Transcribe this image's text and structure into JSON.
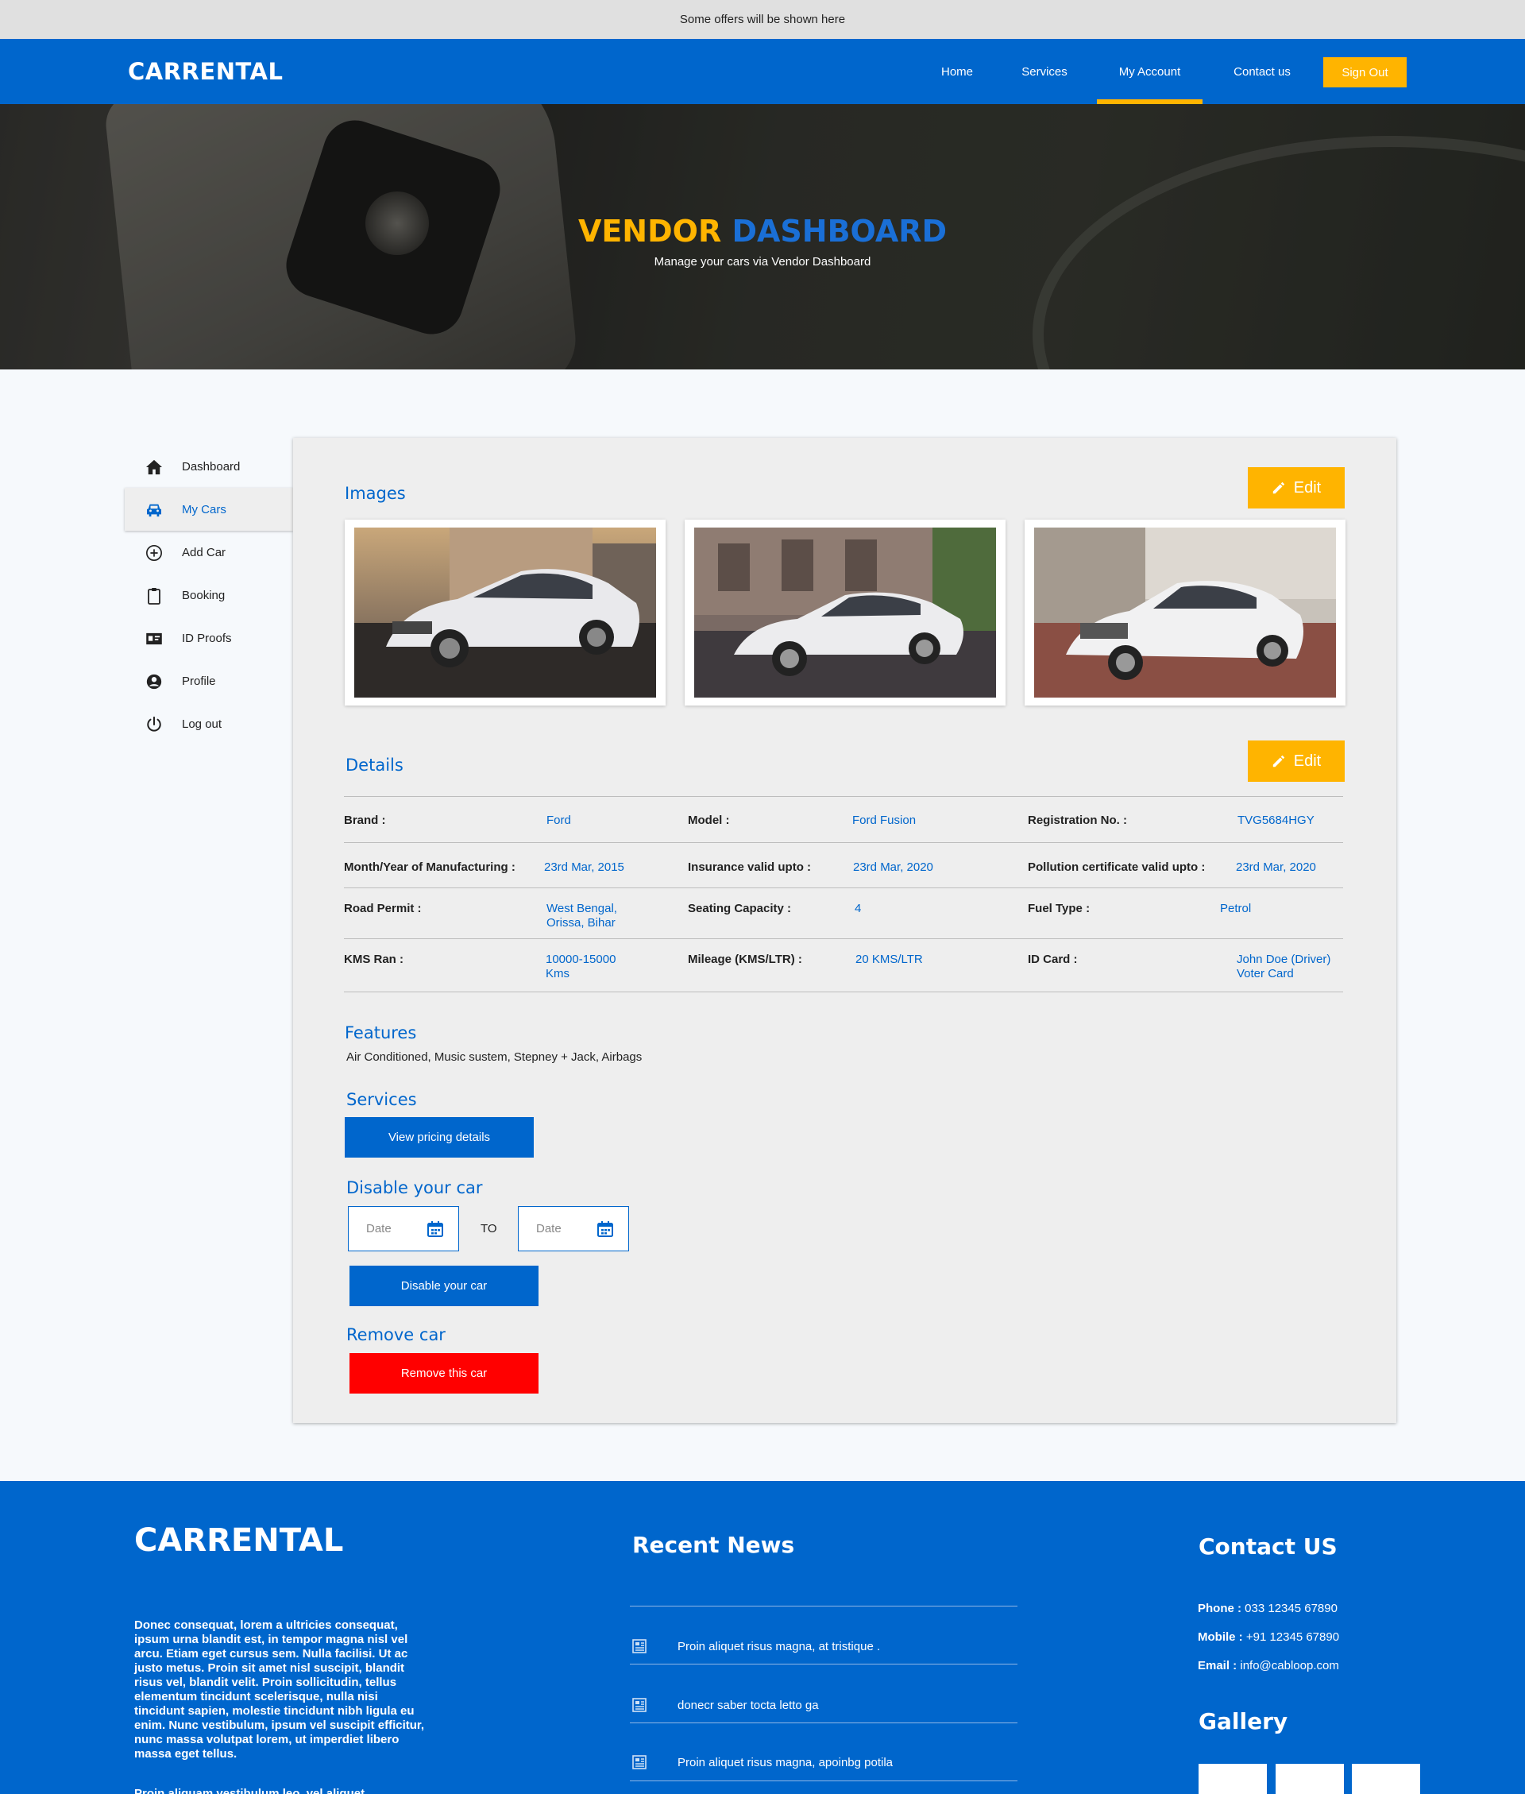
{
  "offer_bar": {
    "text": "Some offers will be shown here"
  },
  "nav": {
    "brand": "CARRENTAL",
    "items": [
      {
        "label": "Home"
      },
      {
        "label": "Services"
      },
      {
        "label": "My Account"
      },
      {
        "label": "Contact us"
      }
    ],
    "signout": "Sign Out"
  },
  "hero": {
    "title_part1": "VENDOR",
    "title_part2": "DASHBOARD",
    "subtitle": "Manage your cars via Vendor Dashboard"
  },
  "sidebar": {
    "items": [
      {
        "label": "Dashboard",
        "icon": "home-icon"
      },
      {
        "label": "My Cars",
        "icon": "car-icon"
      },
      {
        "label": "Add Car",
        "icon": "plus-circle-icon"
      },
      {
        "label": "Booking",
        "icon": "clipboard-icon"
      },
      {
        "label": "ID Proofs",
        "icon": "id-card-icon"
      },
      {
        "label": "Profile",
        "icon": "user-icon"
      },
      {
        "label": "Log out",
        "icon": "power-icon"
      }
    ]
  },
  "images_section": {
    "title": "Images",
    "edit_label": "Edit"
  },
  "details_section": {
    "title": "Details",
    "edit_label": "Edit",
    "rows": [
      [
        {
          "label": "Brand  :",
          "value": "Ford"
        },
        {
          "label": "Model  :",
          "value": "Ford Fusion"
        },
        {
          "label": "Registration No.  :",
          "value": "TVG5684HGY"
        }
      ],
      [
        {
          "label": "Month/Year of Manufacturing  :",
          "value": "23rd Mar, 2015"
        },
        {
          "label": "Insurance valid upto  :",
          "value": "23rd Mar, 2020"
        },
        {
          "label": "Pollution certificate valid upto  :",
          "value": "23rd Mar, 2020"
        }
      ],
      [
        {
          "label": "Road Permit :",
          "value_lines": [
            "West Bengal,",
            "Orissa, Bihar"
          ]
        },
        {
          "label": "Seating Capacity  :",
          "value": "4"
        },
        {
          "label": "Fuel Type  :",
          "value": "Petrol"
        }
      ],
      [
        {
          "label": "KMS Ran :",
          "value_lines": [
            "10000-15000",
            "Kms"
          ]
        },
        {
          "label": "Mileage (KMS/LTR)  :",
          "value": "20 KMS/LTR"
        },
        {
          "label": "ID Card  :",
          "value_lines": [
            "John Doe (Driver)",
            "Voter Card"
          ]
        }
      ]
    ]
  },
  "features": {
    "title": "Features",
    "text": "Air Conditioned,  Music sustem,  Stepney + Jack,  Airbags"
  },
  "services": {
    "title": "Services",
    "button": "View pricing details"
  },
  "disable": {
    "title": "Disable your car",
    "from_placeholder": "Date",
    "to_label": "TO",
    "to_placeholder": "Date",
    "button": "Disable your car"
  },
  "remove": {
    "title": "Remove car",
    "button": "Remove this car"
  },
  "footer": {
    "brand": "CARRENTAL",
    "about": "Donec consequat, lorem a ultricies consequat, ipsum urna blandit est, in tempor magna nisl vel arcu. Etiam eget cursus sem. Nulla facilisi. Ut ac justo metus. Proin sit amet nisl suscipit, blandit risus vel, blandit velit. Proin sollicitudin, tellus elementum tincidunt scelerisque, nulla nisi tincidunt sapien, molestie tincidunt nibh ligula eu enim. Nunc vestibulum, ipsum vel suscipit efficitur, nunc massa volutpat lorem, ut imperdiet libero massa eget tellus.",
    "about_more": "Proin aliquam vestibulum leo, vel aliquet",
    "news_title": "Recent News",
    "news": [
      "Proin aliquet risus magna, at tristique .",
      "donecr saber tocta letto ga",
      "Proin aliquet risus magna, apoinbg potila"
    ],
    "contact_title": "Contact US",
    "phone_label": "Phone :",
    "phone": "033 12345 67890",
    "mobile_label": "Mobile :",
    "mobile": "+91 12345 67890",
    "email_label": "Email :",
    "email": "info@cabloop.com",
    "gallery_title": "Gallery"
  },
  "colors": {
    "primary": "#0066cc",
    "accent": "#ffb400",
    "danger": "#ff0000"
  }
}
